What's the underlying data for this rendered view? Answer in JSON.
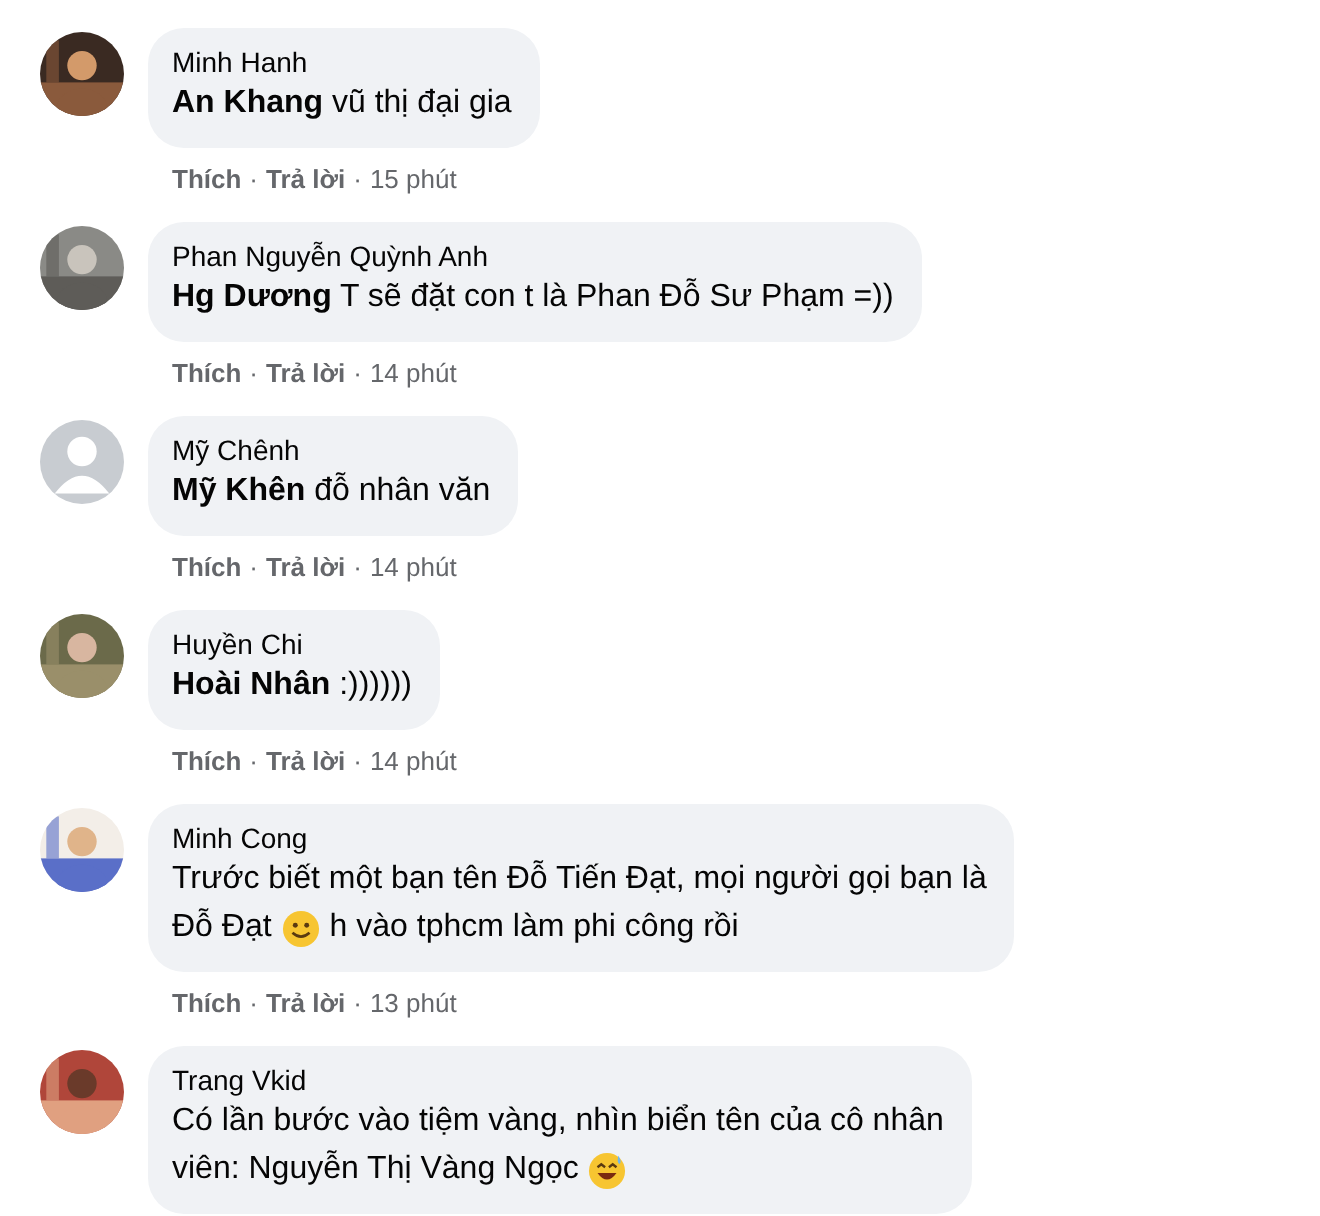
{
  "comments": [
    {
      "author": "Minh Hanh",
      "avatar": {
        "kind": "picture"
      },
      "lines": [
        [
          {
            "kind": "text",
            "text": "**An Khang** vũ thị đại gia"
          }
        ]
      ],
      "actions": {
        "like": "Thích",
        "reply": "Trả lời",
        "time": "15 phút",
        "separator": "·"
      }
    },
    {
      "author": "Phan Nguyễn Quỳnh Anh",
      "avatar": {
        "kind": "picture"
      },
      "lines": [
        [
          {
            "kind": "text",
            "text": "**Hg Dương** T sẽ đặt con t là Phan Đỗ Sư Phạm =))"
          }
        ]
      ],
      "actions": {
        "like": "Thích",
        "reply": "Trả lời",
        "time": "14 phút",
        "separator": "·"
      }
    },
    {
      "author": "Mỹ Chênh",
      "avatar": {
        "kind": "silhouette"
      },
      "lines": [
        [
          {
            "kind": "text",
            "text": "**Mỹ Khên** đỗ nhân văn"
          }
        ]
      ],
      "actions": {
        "like": "Thích",
        "reply": "Trả lời",
        "time": "14 phút",
        "separator": "·"
      }
    },
    {
      "author": "Huyền Chi",
      "avatar": {
        "kind": "picture"
      },
      "lines": [
        [
          {
            "kind": "text",
            "text": "**Hoài Nhân** :))))))"
          }
        ]
      ],
      "actions": {
        "like": "Thích",
        "reply": "Trả lời",
        "time": "14 phút",
        "separator": "·"
      }
    },
    {
      "author": "Minh Cong",
      "avatar": {
        "kind": "picture"
      },
      "lines": [
        [
          {
            "kind": "text",
            "text": "Trước biết một bạn tên Đỗ Tiến Đạt, mọi người gọi bạn là"
          }
        ],
        [
          {
            "kind": "text",
            "text": "Đỗ Đạt"
          },
          {
            "kind": "emoji"
          },
          {
            "kind": "text",
            "text": "h vào tphcm làm phi công rồi"
          }
        ]
      ],
      "actions": {
        "like": "Thích",
        "reply": "Trả lời",
        "time": "13 phút",
        "separator": "·"
      }
    },
    {
      "author": "Trang Vkid",
      "avatar": {
        "kind": "picture"
      },
      "lines": [
        [
          {
            "kind": "text",
            "text": "Có lần bước vào tiệm vàng, nhìn biển tên của cô nhân"
          }
        ],
        [
          {
            "kind": "text",
            "text": "viên: Nguyễn Thị Vàng Ngọc"
          },
          {
            "kind": "emoji-laugh"
          }
        ]
      ]
    }
  ]
}
